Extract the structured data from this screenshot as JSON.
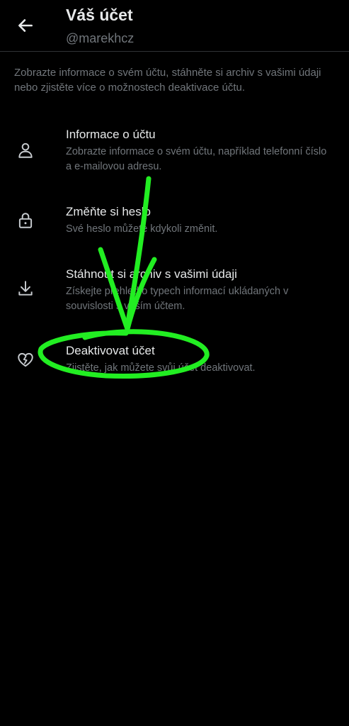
{
  "header": {
    "title": "Váš účet",
    "username": "@marekhcz",
    "back_icon": "arrow-left-icon"
  },
  "intro": "Zobrazte informace o svém účtu, stáhněte si archiv s vašimi údaji nebo zjistěte více o možnostech deaktivace účtu.",
  "items": [
    {
      "icon": "person-icon",
      "title": "Informace o účtu",
      "description": "Zobrazte informace o svém účtu, například telefonní číslo a e-mailovou adresu."
    },
    {
      "icon": "lock-icon",
      "title": "Změňte si heslo",
      "description": "Své heslo můžete kdykoli změnit."
    },
    {
      "icon": "download-icon",
      "title": "Stáhnout si archiv s vašimi údaji",
      "description": "Získejte přehled o typech informací ukládaných v souvislosti s vaším účtem."
    },
    {
      "icon": "broken-heart-icon",
      "title": "Deaktivovat účet",
      "description": "Zjistěte, jak můžete svůj účet deaktivovat."
    }
  ],
  "colors": {
    "background": "#000000",
    "primary_text": "#e7e9ea",
    "secondary_text": "#71767b",
    "divider": "#2f3336",
    "annotation": "#22ff22"
  }
}
